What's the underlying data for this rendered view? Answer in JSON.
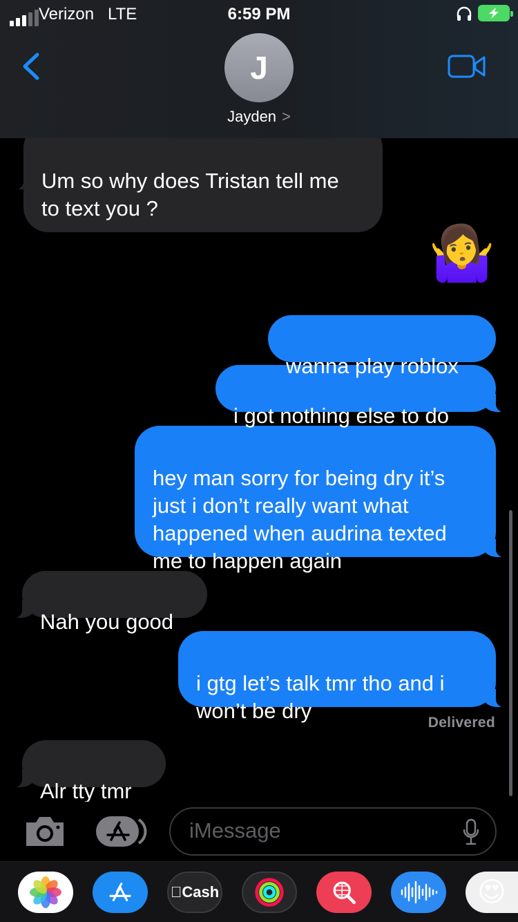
{
  "status_bar": {
    "carrier": "Verizon",
    "network": "LTE",
    "time": "6:59 PM"
  },
  "header": {
    "avatar_initial": "J",
    "contact_name": "Jayden",
    "contact_chevron": ">"
  },
  "messages": [
    {
      "direction": "incoming",
      "text": "Um so why does Tristan tell me\nto text you ?"
    },
    {
      "direction": "outgoing",
      "text": "🤷‍♀️"
    },
    {
      "direction": "outgoing",
      "text": "wanna play roblox"
    },
    {
      "direction": "outgoing",
      "text": "i got nothing else to do"
    },
    {
      "direction": "outgoing",
      "text": "hey man sorry for being dry it’s\njust i don’t really want what\nhappened when audrina texted\nme to happen again"
    },
    {
      "direction": "incoming",
      "text": "Nah you good"
    },
    {
      "direction": "outgoing",
      "text": "i gtg let’s talk tmr tho and i\nwon’t be dry"
    },
    {
      "direction": "incoming",
      "text": "Alr tty tmr"
    }
  ],
  "delivered_label": "Delivered",
  "input": {
    "placeholder": "iMessage"
  },
  "drawer": {
    "cash_label": "Cash",
    "apps": [
      "photos-icon",
      "app-store-icon",
      "apple-cash-icon",
      "activity-icon",
      "image-search-icon",
      "audio-message-icon",
      "memoji-icon"
    ]
  },
  "colors": {
    "outgoing_bubble": "#1a80f7",
    "incoming_bubble": "#262629",
    "accent": "#0a84ff",
    "battery": "#4cd964"
  }
}
